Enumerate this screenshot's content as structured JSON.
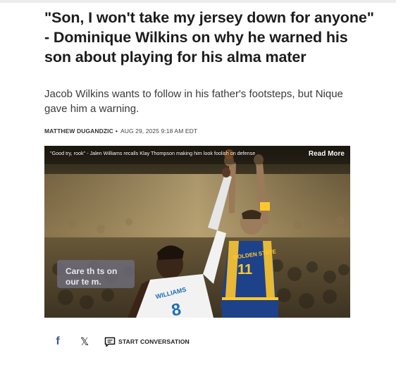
{
  "article": {
    "headline": "\"Son, I won't take my jersey down for anyone\" - Dominique Wilkins on why he warned his son about playing for his alma mater",
    "subheadline": "Jacob Wilkins wants to follow in his father's footsteps, but Nique gave him a warning.",
    "author": "MATTHEW DUGANDZIC",
    "date": "AUG 29, 2025 9:18 AM EDT"
  },
  "media": {
    "video_title": "\"Good try, rook\" - Jalen Williams recalls Klay Thompson making him look foolish on defense",
    "read_more_label": "Read More",
    "player_left_name": "WILLIAMS",
    "player_left_number": "8",
    "player_right_team": "GOLDEN STATE",
    "player_right_number": "11",
    "banner_text": "Care that's on our team."
  },
  "share": {
    "facebook_icon": "facebook-icon",
    "x_icon": "x-icon",
    "conversation_icon": "comment-icon",
    "conversation_label": "START CONVERSATION"
  },
  "colors": {
    "gsw_blue": "#1d428a",
    "gsw_gold": "#ffc72c",
    "facebook_blue": "#3b5998"
  }
}
